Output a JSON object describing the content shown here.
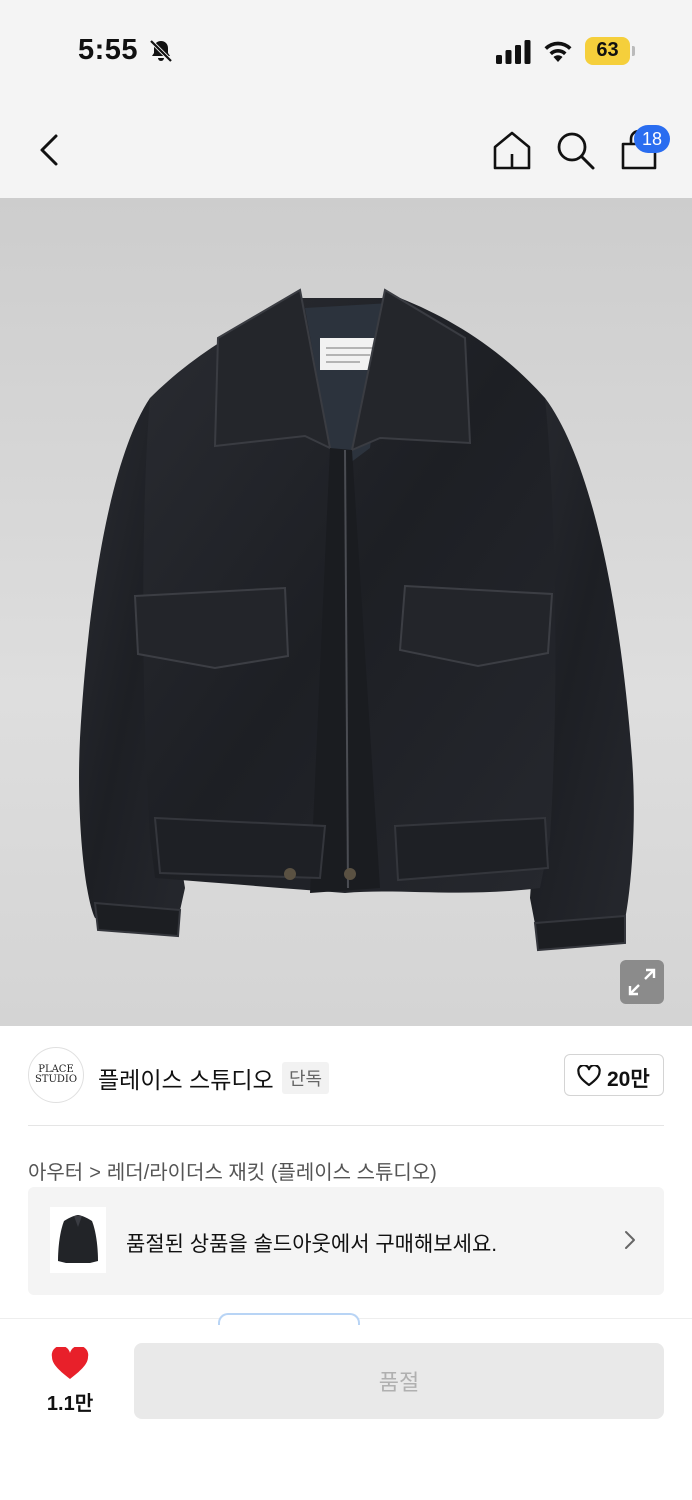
{
  "status_bar": {
    "time": "5:55",
    "battery_level": "63"
  },
  "nav": {
    "cart_count": "18"
  },
  "brand": {
    "logo_text": "PLACE STUDIO",
    "name": "플레이스 스튜디오",
    "tag": "단독",
    "like_count": "20만"
  },
  "breadcrumb": {
    "category": "아우터",
    "separator": ">",
    "subcategory": "레더/라이더스 재킷 (플레이스 스튜디오)"
  },
  "soldout_banner": {
    "text": "품절된 상품을 솔드아웃에서 구매해보세요."
  },
  "bottom": {
    "like_count": "1.1만",
    "buy_label": "품절"
  },
  "colors": {
    "badge": "#2a6df0",
    "battery": "#f5cf3b",
    "heart": "#e8202a",
    "disabled_button": "#e9e9e9"
  },
  "icons": [
    "bell-off-icon",
    "signal-icon",
    "wifi-icon",
    "back-icon",
    "home-icon",
    "search-icon",
    "shopping-bag-icon",
    "expand-icon",
    "heart-outline-icon",
    "chevron-right-icon",
    "heart-filled-icon"
  ]
}
